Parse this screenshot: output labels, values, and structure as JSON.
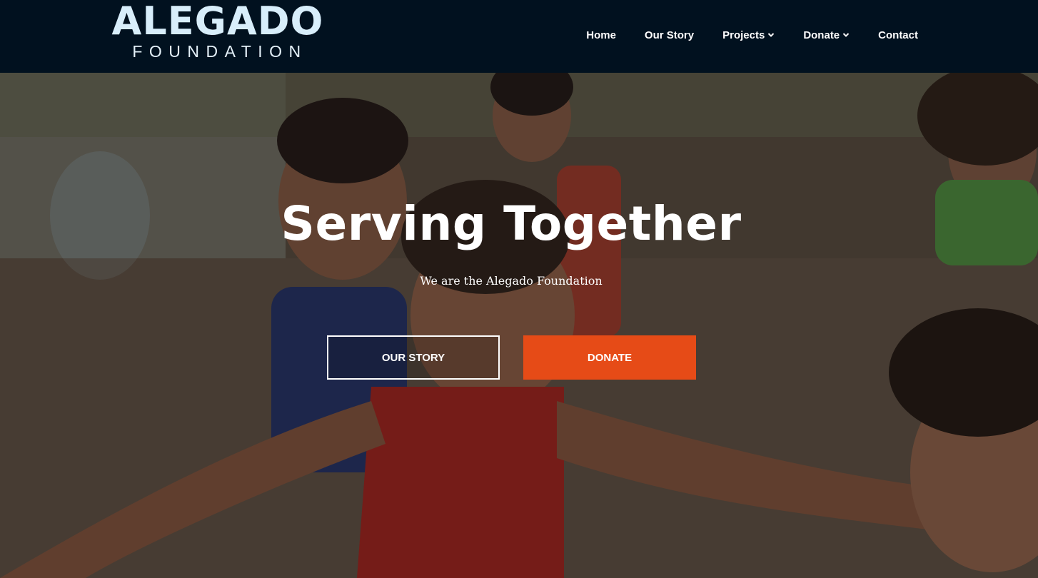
{
  "brand": {
    "name_main": "ALEGADO",
    "name_sub": "FOUNDATION"
  },
  "nav": {
    "items": [
      {
        "label": "Home",
        "has_dropdown": false
      },
      {
        "label": "Our Story",
        "has_dropdown": false
      },
      {
        "label": "Projects",
        "has_dropdown": true
      },
      {
        "label": "Donate",
        "has_dropdown": true
      },
      {
        "label": "Contact",
        "has_dropdown": false
      }
    ]
  },
  "hero": {
    "title": "Serving Together",
    "subtitle": "We are the Alegado Foundation",
    "primary_button": "OUR STORY",
    "secondary_button": "DONATE",
    "background_icon": "photo-children-playing"
  },
  "colors": {
    "header_bg": "#01111f",
    "logo": "#d8eefb",
    "accent": "#e64b17",
    "text": "#ffffff"
  }
}
